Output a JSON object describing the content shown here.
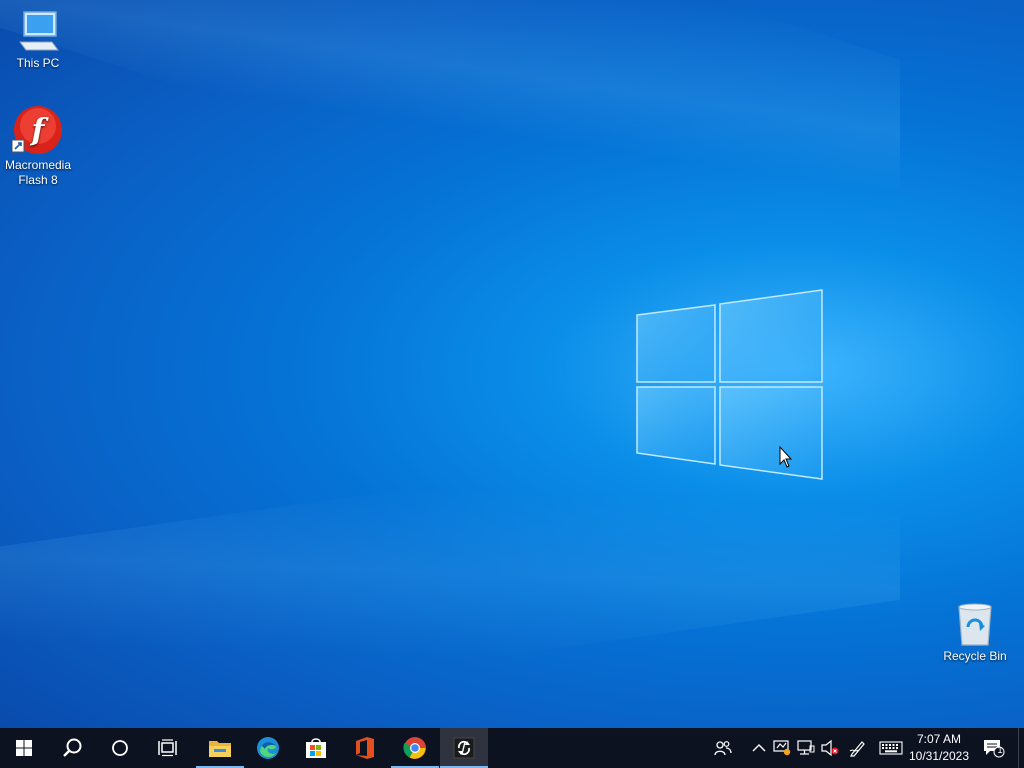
{
  "desktop": {
    "icons": [
      {
        "label": "This PC",
        "icon": "computer-icon"
      },
      {
        "label": "Macromedia Flash 8",
        "icon": "flash-icon"
      },
      {
        "label": "Recycle Bin",
        "icon": "recycle-bin-icon"
      }
    ],
    "wallpaper": "windows-10-hero",
    "accent_color": "#0a78d7"
  },
  "taskbar": {
    "start": {
      "icon": "windows-start-icon"
    },
    "search": {
      "icon": "search-icon"
    },
    "cortana": {
      "icon": "cortana-icon"
    },
    "task_view": {
      "icon": "task-view-icon"
    },
    "apps": [
      {
        "name": "File Explorer",
        "icon": "folder-icon",
        "running": true
      },
      {
        "name": "Microsoft Edge",
        "icon": "edge-icon",
        "running": false
      },
      {
        "name": "Microsoft Store",
        "icon": "store-icon",
        "running": false
      },
      {
        "name": "Office",
        "icon": "office-icon",
        "running": false
      },
      {
        "name": "Google Chrome",
        "icon": "chrome-icon",
        "running": true
      },
      {
        "name": "Sync app",
        "icon": "sync-icon",
        "running": true,
        "active": true
      }
    ],
    "tray": {
      "icons": [
        "people-icon",
        "chevron-up-icon",
        "network-warning-icon",
        "network-icon",
        "volume-muted-icon",
        "pen-icon",
        "keyboard-icon"
      ],
      "time": "7:07 AM",
      "date": "10/31/2023",
      "notification_count": "1"
    }
  }
}
